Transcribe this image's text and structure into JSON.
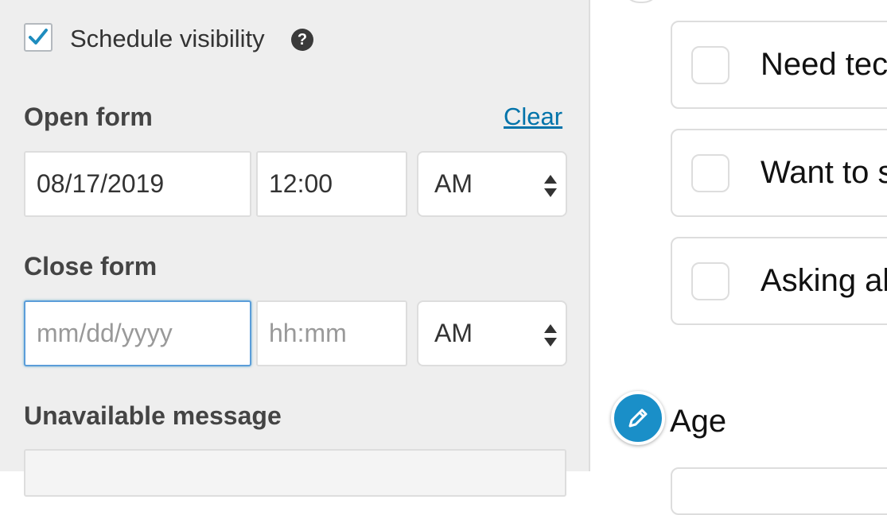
{
  "settings": {
    "schedule_visibility": {
      "label": "Schedule visibility",
      "checked": true,
      "help_icon": "question-circle-icon"
    },
    "open_form": {
      "label": "Open form",
      "clear_label": "Clear",
      "date": "08/17/2019",
      "time": "12:00",
      "ampm": "AM"
    },
    "close_form": {
      "label": "Close form",
      "date_placeholder": "mm/dd/yyyy",
      "time_placeholder": "hh:mm",
      "ampm": "AM"
    },
    "unavailable_message": {
      "label": "Unavailable message"
    }
  },
  "preview": {
    "options": [
      {
        "label": "Need tec"
      },
      {
        "label": "Want to s"
      },
      {
        "label": "Asking al"
      }
    ],
    "field": {
      "label": "Age",
      "edit_icon": "pencil-icon"
    }
  },
  "colors": {
    "accent": "#1a8fc8",
    "link": "#0073aa",
    "panel_bg": "#eeeeee"
  }
}
